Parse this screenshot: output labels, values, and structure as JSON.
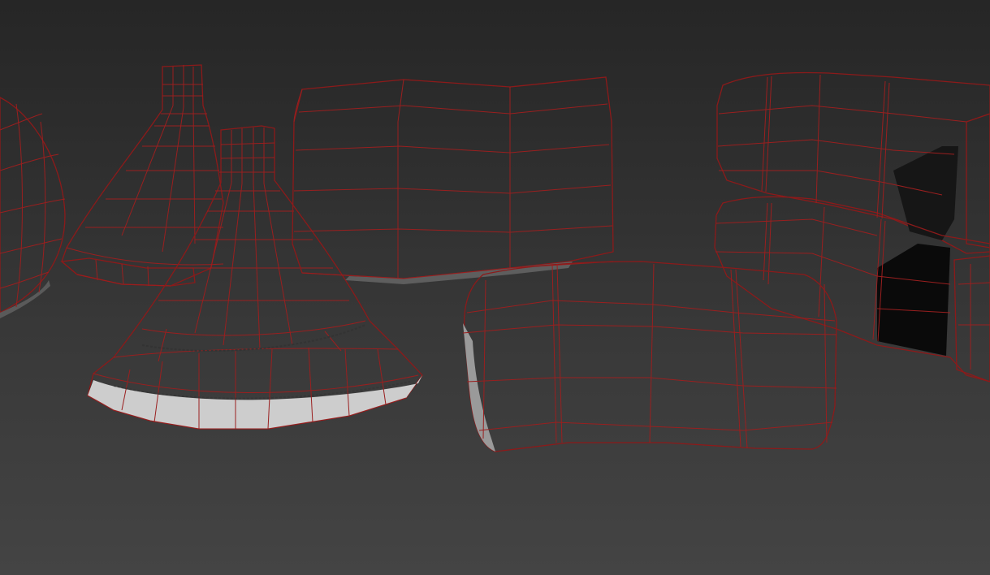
{
  "viewport": {
    "label": "",
    "background_top": "#262626",
    "background_bottom": "#444444",
    "wire_color": "#9a1f1f",
    "objects": [
      {
        "kind": "sphere-partial",
        "icon": "sphere-mesh"
      },
      {
        "kind": "funnel-back",
        "icon": "funnel-mesh"
      },
      {
        "kind": "funnel-front",
        "icon": "funnel-mesh"
      },
      {
        "kind": "curved-panel",
        "icon": "bent-box-mesh"
      },
      {
        "kind": "cushion-block",
        "icon": "rounded-box-mesh"
      },
      {
        "kind": "cushion-stack",
        "icon": "rounded-box-mesh"
      }
    ]
  }
}
